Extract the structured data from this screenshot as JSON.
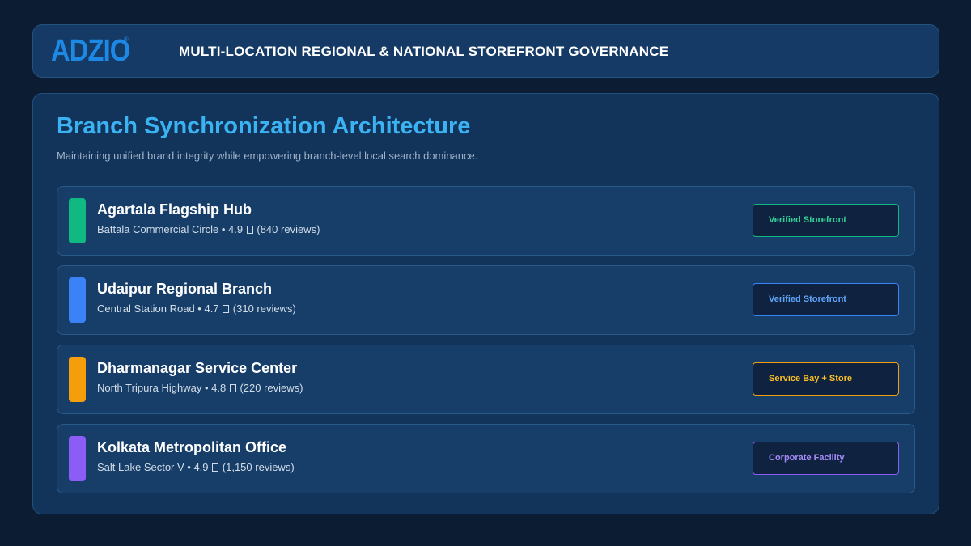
{
  "header": {
    "logo_text": "ADZIO",
    "logo_mark": "®",
    "title": "MULTI-LOCATION REGIONAL & NATIONAL STOREFRONT GOVERNANCE"
  },
  "panel": {
    "title": "Branch Synchronization Architecture",
    "subtitle": "Maintaining unified brand integrity while empowering branch-level local search dominance."
  },
  "branches": [
    {
      "name": "Agartala Flagship Hub",
      "address": "Battala Commercial Circle",
      "rating": "4.9",
      "reviews": "(840 reviews)",
      "badge": "Verified Storefront",
      "accent": "#10b981",
      "badge_color": "#34d399"
    },
    {
      "name": "Udaipur Regional Branch",
      "address": "Central Station Road",
      "rating": "4.7",
      "reviews": "(310 reviews)",
      "badge": "Verified Storefront",
      "accent": "#3b82f6",
      "badge_color": "#60a5fa"
    },
    {
      "name": "Dharmanagar Service Center",
      "address": "North Tripura Highway",
      "rating": "4.8",
      "reviews": "(220 reviews)",
      "badge": "Service Bay + Store",
      "accent": "#f59e0b",
      "badge_color": "#fbbf24"
    },
    {
      "name": "Kolkata Metropolitan Office",
      "address": "Salt Lake Sector V",
      "rating": "4.9",
      "reviews": "(1,150 reviews)",
      "badge": "Corporate Facility",
      "accent": "#8b5cf6",
      "badge_color": "#a78bfa"
    }
  ],
  "icons": {
    "rating": "star-icon"
  }
}
